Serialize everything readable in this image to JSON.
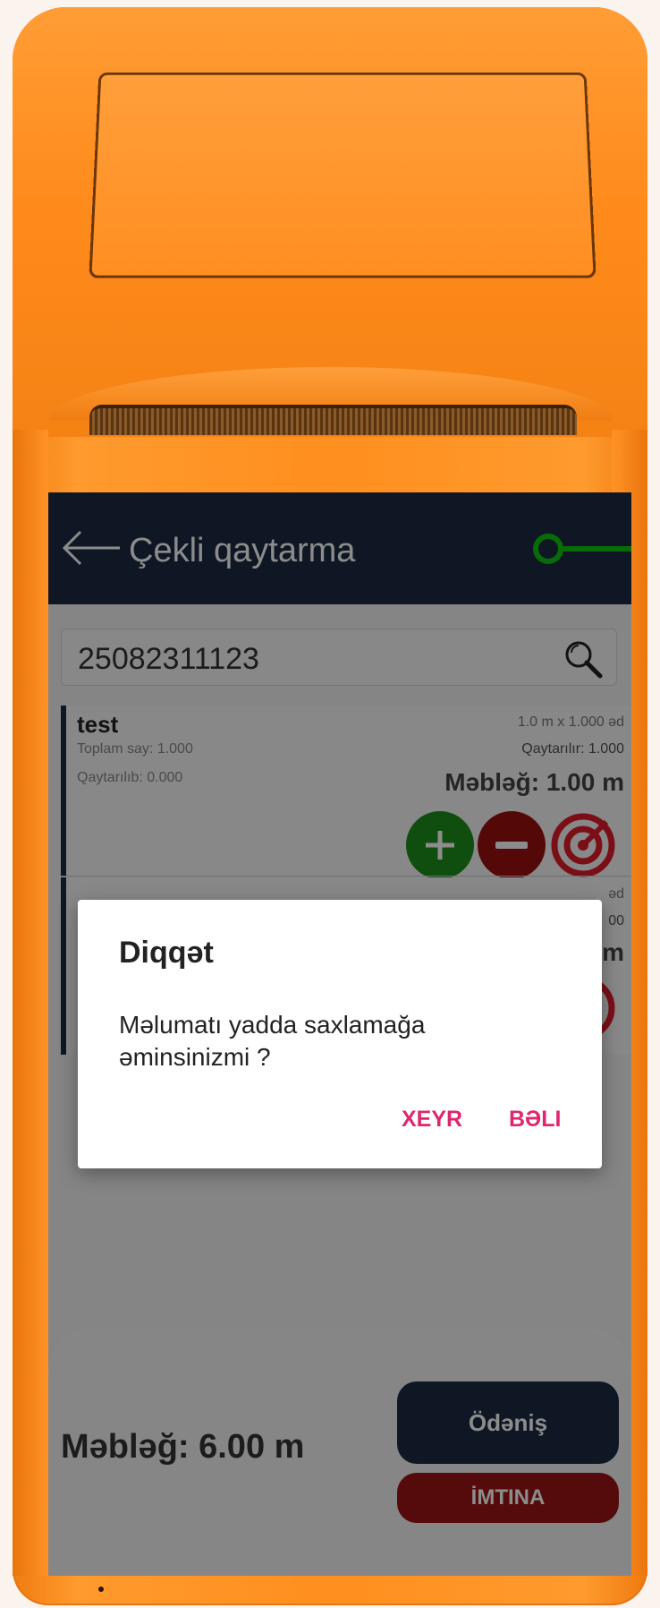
{
  "appbar": {
    "title": "Çekli qaytarma"
  },
  "search": {
    "value": "25082311123"
  },
  "items": [
    {
      "name": "test",
      "total_qty": "Toplam say: 1.000",
      "returned": "Qaytarılıb: 0.000",
      "price": "1.0 m x 1.000 əd",
      "returning": "Qaytarılır: 1.000",
      "amount": "Məbləğ: 1.00 m"
    },
    {
      "price_partial": "əd",
      "returning_partial": "00",
      "amount_partial": "m"
    }
  ],
  "footer": {
    "total": "Məbləğ: 6.00 m",
    "pay_label": "Ödəniş",
    "cancel_label": "İMTINA"
  },
  "dialog": {
    "title": "Diqqət",
    "message": "Məlumatı yadda saxlamağa əminsinizmi ?",
    "no_label": "XEYR",
    "yes_label": "BƏLI"
  },
  "colors": {
    "device": "#ff8f1e",
    "appbar": "#1c2b43",
    "plus": "#1d8f1d",
    "minus": "#9b1010",
    "dialog_button": "#e0266f",
    "tap_marker": "#0ec40e"
  }
}
